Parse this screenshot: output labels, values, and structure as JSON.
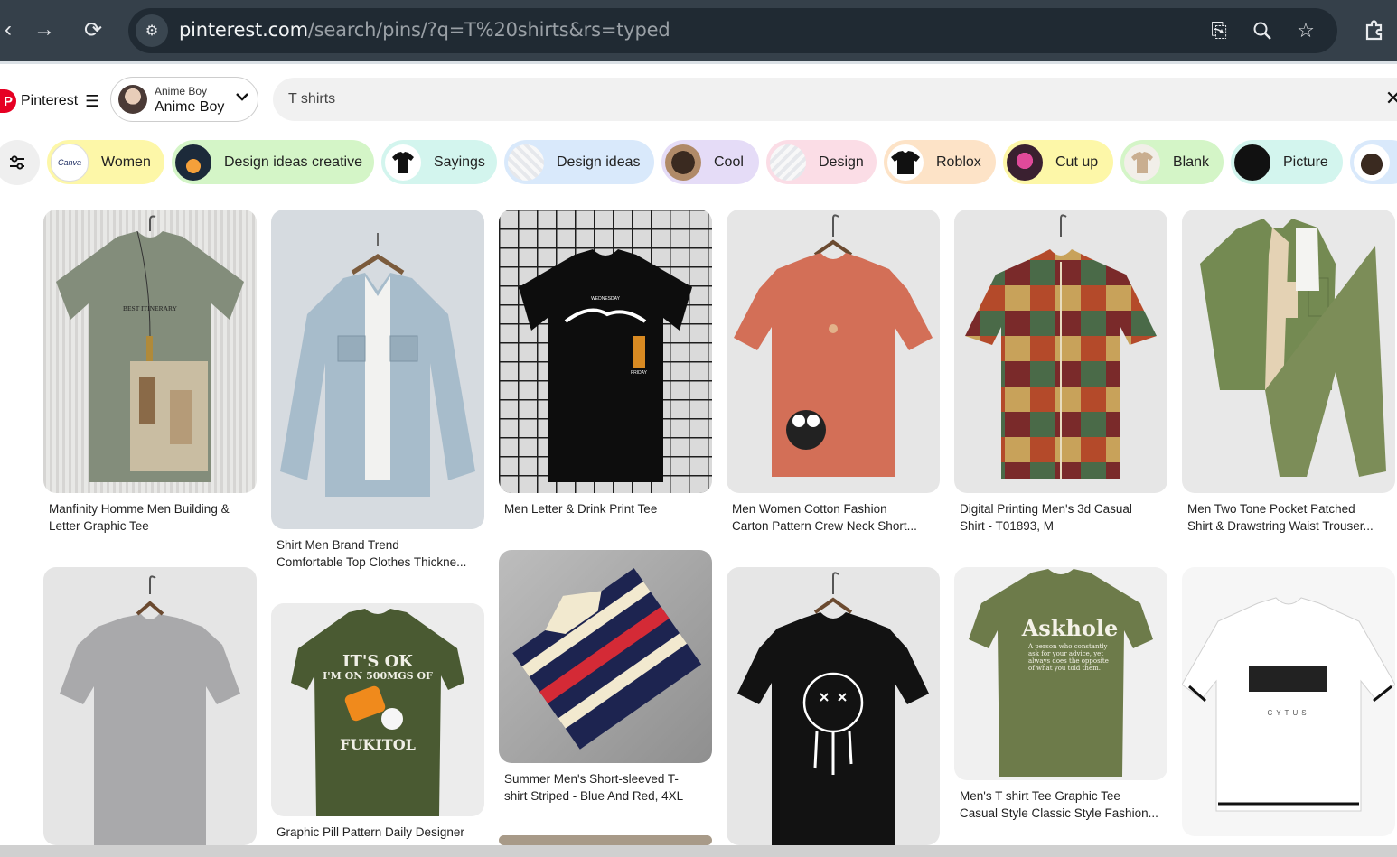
{
  "browser": {
    "url_host": "pinterest.com",
    "url_path": "/search/pins/?q=T%20shirts&rs=typed"
  },
  "header": {
    "logo_text": "Pinterest",
    "profile_small": "Anime Boy",
    "profile_name": "Anime Boy",
    "search_value": "T shirts"
  },
  "chips": [
    {
      "label": "Women",
      "bg": "#fdf7a8"
    },
    {
      "label": "Design ideas creative",
      "bg": "#d4f5c7"
    },
    {
      "label": "Sayings",
      "bg": "#d3f5ee"
    },
    {
      "label": "Design ideas",
      "bg": "#d9e9fb"
    },
    {
      "label": "Cool",
      "bg": "#e5dcf7"
    },
    {
      "label": "Design",
      "bg": "#fbdde6"
    },
    {
      "label": "Roblox",
      "bg": "#fde3c7"
    },
    {
      "label": "Cut up",
      "bg": "#fdf7a8"
    },
    {
      "label": "Blank",
      "bg": "#d4f5c7"
    },
    {
      "label": "Picture",
      "bg": "#d3f5ee"
    }
  ],
  "pins": [
    {
      "line1": "Manfinity Homme Men Building &",
      "line2": "Letter Graphic Tee"
    },
    {
      "line1": "Shirt Men Brand Trend",
      "line2": "Comfortable Top Clothes Thickne..."
    },
    {
      "line1": "Men Letter & Drink Print Tee",
      "line2": ""
    },
    {
      "line1": "Men Women Cotton Fashion",
      "line2": "Carton Pattern Crew Neck Short..."
    },
    {
      "line1": "Digital Printing Men's 3d Casual",
      "line2": "Shirt - T01893, M"
    },
    {
      "line1": "Men Two Tone Pocket Patched",
      "line2": "Shirt & Drawstring Waist Trouser..."
    },
    {
      "line1": "",
      "line2": ""
    },
    {
      "line1": "Graphic Pill Pattern Daily Designer",
      "line2": ""
    },
    {
      "line1": "Summer Men's Short-sleeved T-",
      "line2": "shirt Striped - Blue And Red, 4XL"
    },
    {
      "line1": "",
      "line2": ""
    },
    {
      "line1": "Men's T shirt Tee Graphic Tee",
      "line2": "Casual Style Classic Style Fashion..."
    },
    {
      "line1": "",
      "line2": ""
    }
  ],
  "shirt_prints": {
    "p1": "BEST ITINERARY",
    "p3a": "WEDNESDAY",
    "p3b": "FRIDAY",
    "p8a": "IT'S OK",
    "p8b": "I'M ON 500MGS OF",
    "p8c": "FUKITOL",
    "p11a": "Askhole",
    "p11b": "A person who constantly ask for your advice, yet always does the opposite of what you told them.",
    "p12": "CYTUS"
  },
  "colors": {
    "brand": "#e60023",
    "chrome_bg": "#35404a",
    "omnibox_bg": "#202a33"
  }
}
